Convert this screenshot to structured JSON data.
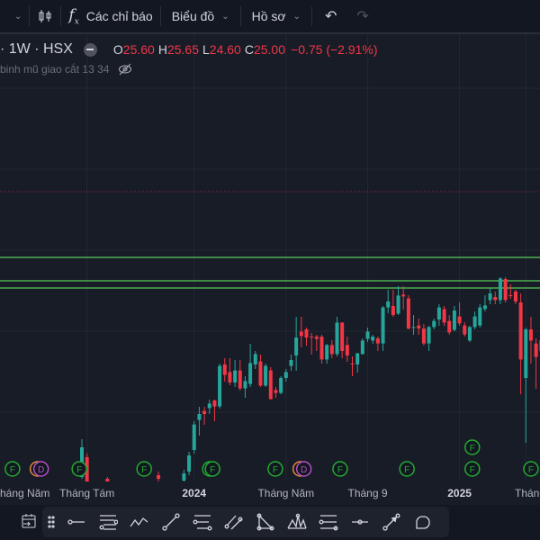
{
  "toolbar": {
    "indicators_label": "Các chỉ báo",
    "chart_label": "Biểu đồ",
    "profile_label": "Hồ sơ"
  },
  "legend": {
    "symbol": "· 1W · HSX",
    "open_label": "O",
    "open": "25.60",
    "high_label": "H",
    "high": "25.65",
    "low_label": "L",
    "low": "24.60",
    "close_label": "C",
    "close": "25.00",
    "change": "−0.75 (−2.91%)"
  },
  "indicator": {
    "label": "binh mũ giao cắt 13 34"
  },
  "colors": {
    "up": "#26a69a",
    "down": "#f23645",
    "level": "#4caf50",
    "alert": "#9c2b3f",
    "bg": "#181c27"
  },
  "xaxis": {
    "labels": [
      {
        "text": "háng Năm",
        "bold": false,
        "week": -17
      },
      {
        "text": "Tháng Tám",
        "bold": false,
        "week": 1
      },
      {
        "text": "2024",
        "bold": true,
        "week": 22
      },
      {
        "text": "Tháng Năm",
        "bold": false,
        "week": 40
      },
      {
        "text": "Tháng 9",
        "bold": false,
        "week": 56
      },
      {
        "text": "2025",
        "bold": true,
        "week": 74
      },
      {
        "text": "Tháng",
        "bold": false,
        "week": 87
      }
    ]
  },
  "chart_data": {
    "type": "candlestick",
    "interval": "1W",
    "exchange": "HSX",
    "price_range": [
      17.5,
      40
    ],
    "levels": [
      {
        "price": 33.85,
        "style": "dotted",
        "color": "alert"
      },
      {
        "price": 30.2,
        "style": "solid",
        "color": "level"
      },
      {
        "price": 28.9,
        "style": "solid",
        "color": "level"
      },
      {
        "price": 28.5,
        "style": "solid",
        "color": "level"
      }
    ],
    "candles_ohlc": [
      [
        18.0,
        20.1,
        17.9,
        19.65
      ],
      [
        19.1,
        19.3,
        17.7,
        17.75
      ],
      null,
      null,
      null,
      [
        17.9,
        18.0,
        17.6,
        17.7
      ],
      null,
      null,
      null,
      null,
      null,
      null,
      null,
      null,
      null,
      [
        18.1,
        18.3,
        17.7,
        17.9
      ],
      null,
      null,
      null,
      null,
      [
        17.8,
        18.4,
        17.7,
        18.2
      ],
      [
        18.3,
        19.4,
        18.1,
        19.2
      ],
      [
        19.5,
        21.1,
        19.3,
        20.92
      ],
      [
        21.17,
        21.9,
        20.3,
        21.5
      ],
      [
        21.67,
        21.9,
        20.9,
        21.5
      ],
      [
        21.83,
        22.3,
        21.5,
        22.08
      ],
      [
        22.25,
        22.3,
        21.1,
        21.92
      ],
      [
        21.92,
        24.3,
        21.8,
        24.17
      ],
      [
        24.25,
        24.6,
        23.3,
        23.67
      ],
      [
        23.83,
        24.6,
        23.1,
        23.25
      ],
      [
        23.25,
        24.5,
        23.0,
        23.92
      ],
      [
        23.92,
        24.5,
        22.8,
        22.92
      ],
      [
        22.92,
        23.6,
        22.4,
        23.33
      ],
      [
        23.17,
        25.4,
        23.0,
        24.33
      ],
      [
        24.25,
        25.0,
        24.0,
        24.83
      ],
      [
        24.42,
        24.8,
        23.0,
        23.08
      ],
      [
        23.08,
        24.3,
        23.0,
        24.17
      ],
      [
        23.92,
        24.1,
        22.3,
        22.33
      ],
      [
        22.83,
        23.0,
        22.4,
        22.67
      ],
      [
        22.67,
        23.6,
        22.6,
        23.5
      ],
      [
        23.5,
        24.0,
        23.3,
        23.83
      ],
      [
        24.17,
        24.8,
        23.9,
        24.5
      ],
      [
        24.75,
        26.9,
        23.9,
        25.75
      ],
      [
        26.08,
        26.9,
        25.2,
        25.83
      ],
      [
        26.2,
        26.3,
        25.3,
        25.75
      ],
      [
        25.8,
        26.0,
        24.8,
        25.75
      ],
      [
        25.8,
        25.9,
        25.0,
        25.67
      ],
      [
        25.8,
        25.9,
        24.3,
        24.53
      ],
      [
        24.53,
        25.4,
        24.3,
        25.33
      ],
      [
        25.33,
        25.6,
        24.6,
        24.83
      ],
      [
        24.83,
        26.9,
        24.7,
        26.58
      ],
      [
        26.58,
        26.6,
        24.6,
        25.0
      ],
      [
        25.33,
        25.8,
        24.4,
        24.75
      ],
      [
        24.3,
        24.7,
        23.6,
        24.25
      ],
      [
        24.25,
        24.9,
        23.8,
        24.87
      ],
      [
        24.83,
        25.7,
        24.8,
        25.58
      ],
      [
        25.67,
        26.3,
        25.5,
        26.08
      ],
      [
        25.58,
        25.9,
        25.4,
        25.8
      ],
      [
        25.7,
        25.8,
        25.0,
        25.42
      ],
      [
        25.42,
        27.5,
        25.0,
        27.42
      ],
      [
        27.42,
        28.4,
        27.1,
        27.75
      ],
      [
        27.5,
        28.4,
        26.9,
        27.0
      ],
      [
        27.08,
        28.6,
        27.0,
        28.08
      ],
      [
        28.13,
        28.6,
        27.3,
        28.03
      ],
      [
        27.92,
        28.1,
        26.2,
        26.25
      ],
      [
        26.3,
        27.0,
        25.9,
        26.33
      ],
      [
        26.42,
        26.8,
        25.9,
        26.25
      ],
      [
        26.25,
        26.5,
        25.3,
        25.42
      ],
      [
        25.42,
        26.4,
        25.0,
        26.33
      ],
      [
        26.33,
        26.8,
        26.2,
        26.67
      ],
      [
        26.75,
        27.6,
        26.4,
        27.42
      ],
      [
        27.33,
        27.5,
        26.4,
        26.58
      ],
      [
        26.67,
        27.0,
        25.9,
        26.03
      ],
      [
        26.17,
        27.5,
        26.1,
        27.25
      ],
      [
        26.92,
        27.7,
        26.4,
        26.53
      ],
      [
        26.42,
        26.6,
        25.8,
        25.92
      ],
      [
        25.58,
        26.4,
        25.5,
        26.33
      ],
      [
        26.33,
        27.2,
        26.2,
        26.92
      ],
      [
        26.42,
        27.6,
        26.3,
        27.42
      ],
      [
        27.33,
        28.1,
        27.2,
        27.53
      ],
      [
        27.83,
        28.5,
        27.6,
        28.2
      ],
      [
        28.0,
        28.3,
        27.6,
        27.83
      ],
      [
        27.83,
        29.1,
        27.6,
        29.03
      ],
      [
        29.0,
        29.1,
        27.7,
        27.83
      ],
      [
        28.1,
        28.7,
        27.9,
        28.05
      ],
      [
        28.3,
        28.4,
        27.6,
        27.75
      ],
      [
        27.7,
        28.2,
        22.6,
        24.53
      ],
      [
        23.5,
        26.3,
        19.9,
        26.2
      ],
      [
        26.2,
        26.9,
        24.3,
        25.58
      ],
      [
        25.42,
        25.7,
        22.9,
        24.67
      ],
      [
        25.6,
        25.65,
        24.6,
        25.0
      ]
    ],
    "events": [
      {
        "type": "F",
        "week": -13.6,
        "row": 0
      },
      {
        "type": "D",
        "week": -8,
        "row": 0,
        "mixed": true
      },
      {
        "type": "F",
        "week": -0.5,
        "row": 0
      },
      {
        "type": "F",
        "week": 12.2,
        "row": 0
      },
      {
        "type": "F",
        "week": 25.6,
        "row": 0,
        "double": true
      },
      {
        "type": "F",
        "week": 37.9,
        "row": 0
      },
      {
        "type": "D",
        "week": 43.5,
        "row": 0,
        "mixed": true
      },
      {
        "type": "F",
        "week": 50.6,
        "row": 0
      },
      {
        "type": "F",
        "week": 63.7,
        "row": 0
      },
      {
        "type": "F",
        "week": 76.5,
        "row": 0
      },
      {
        "type": "F",
        "week": 76.5,
        "row": 1
      },
      {
        "type": "F",
        "week": 88,
        "row": 0
      }
    ]
  }
}
